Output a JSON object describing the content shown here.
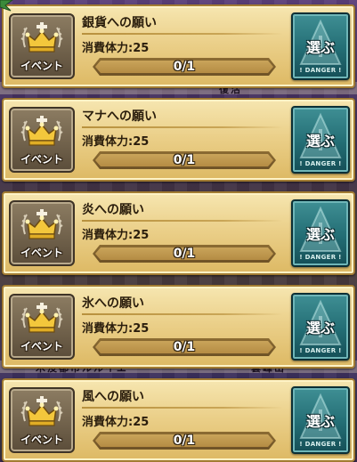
{
  "badge_label": "イベント",
  "cost_label": "消費体力:25",
  "select_label": "選ぶ",
  "danger_label": "! DANGER !",
  "background_text": {
    "gap1": "復活",
    "gap4": "木没都市ルルイエ",
    "gap4b": "雲峰山"
  },
  "quests": [
    {
      "title": "銀貨への願い",
      "progress_text": "0/1",
      "progress": 0.0
    },
    {
      "title": "マナへの願い",
      "progress_text": "0/1",
      "progress": 0.0
    },
    {
      "title": "炎への願い",
      "progress_text": "0/1",
      "progress": 0.0
    },
    {
      "title": "氷への願い",
      "progress_text": "0/1",
      "progress": 0.0
    },
    {
      "title": "風への願い",
      "progress_text": "0/1",
      "progress": 0.0
    }
  ],
  "colors": {
    "card": "#ebd08a",
    "select_button": "#236d74",
    "badge": "#6f604a"
  }
}
